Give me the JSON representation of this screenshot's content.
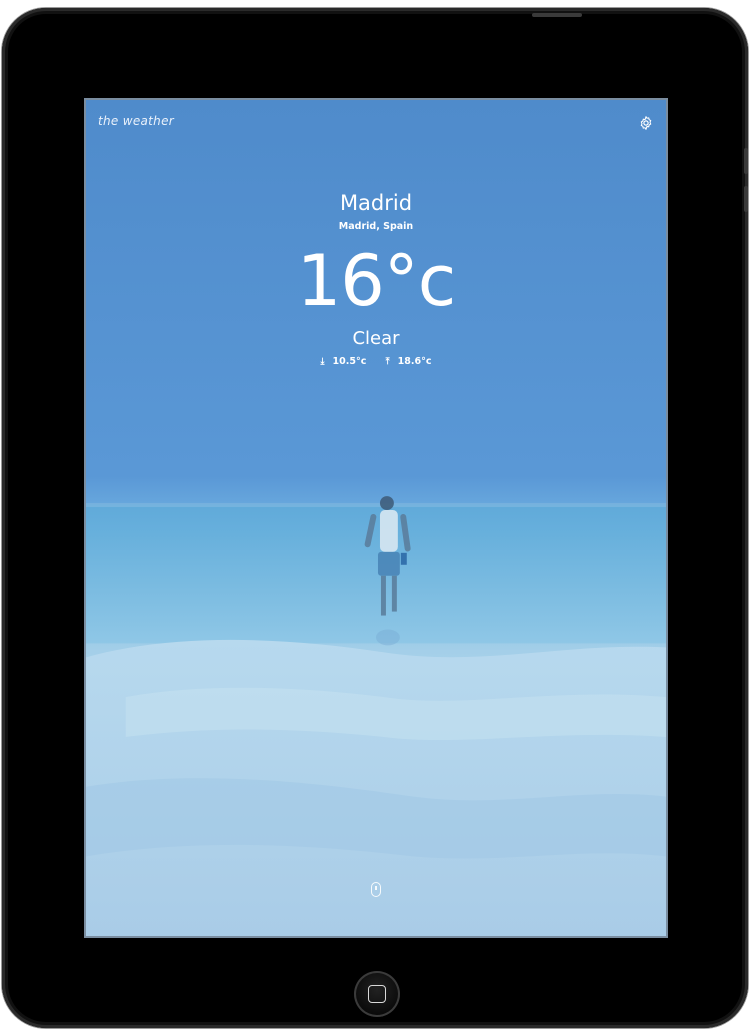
{
  "app": {
    "title": "the weather"
  },
  "weather": {
    "city": "Madrid",
    "region": "Madrid, Spain",
    "temperature": "16°c",
    "condition": "Clear",
    "min_temp": "10.5°c",
    "max_temp": "18.6°c"
  },
  "icons": {
    "settings": "gear-icon",
    "min_arrow": "arrow-down-icon",
    "max_arrow": "arrow-up-icon",
    "scroll": "mouse-scroll-icon"
  },
  "colors": {
    "sky": "#4f8bcb",
    "text": "#ffffff",
    "device": "#000000"
  }
}
